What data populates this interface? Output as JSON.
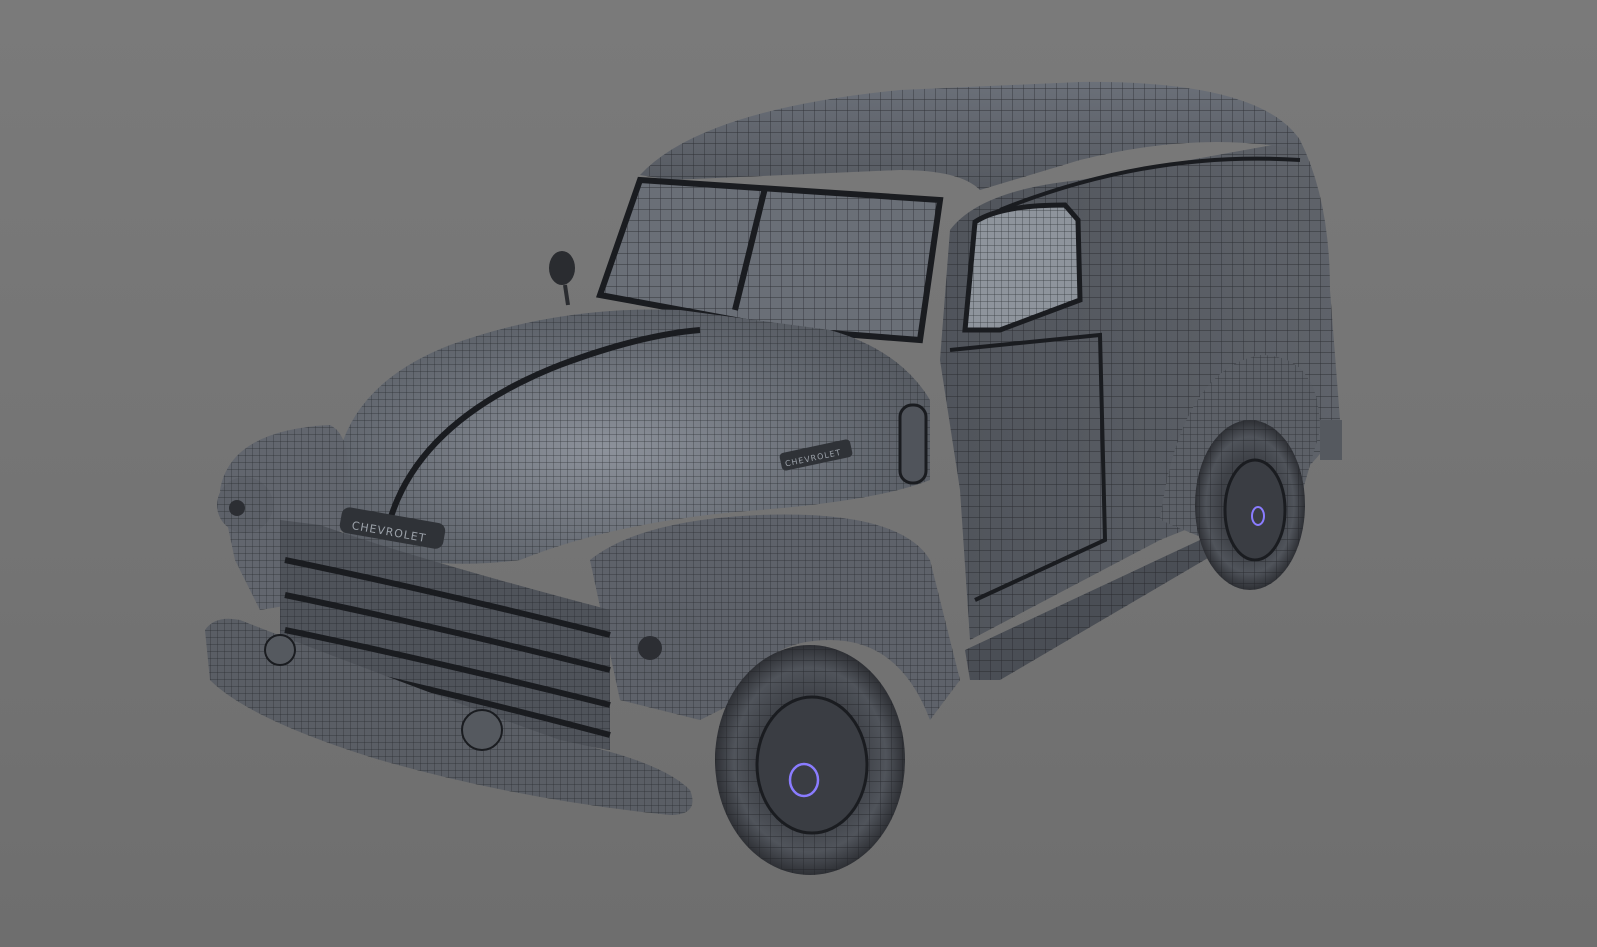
{
  "scene": {
    "subject": "wireframe vehicle model",
    "background_color": "#757575",
    "body_color": "#5b5f66",
    "wire_color": "#1e2024",
    "highlight_color": "#8a8f98",
    "hub_accent_color": "#8a7cff"
  },
  "emblems": {
    "hood": "CHEVROLET",
    "side": "CHEVROLET"
  }
}
